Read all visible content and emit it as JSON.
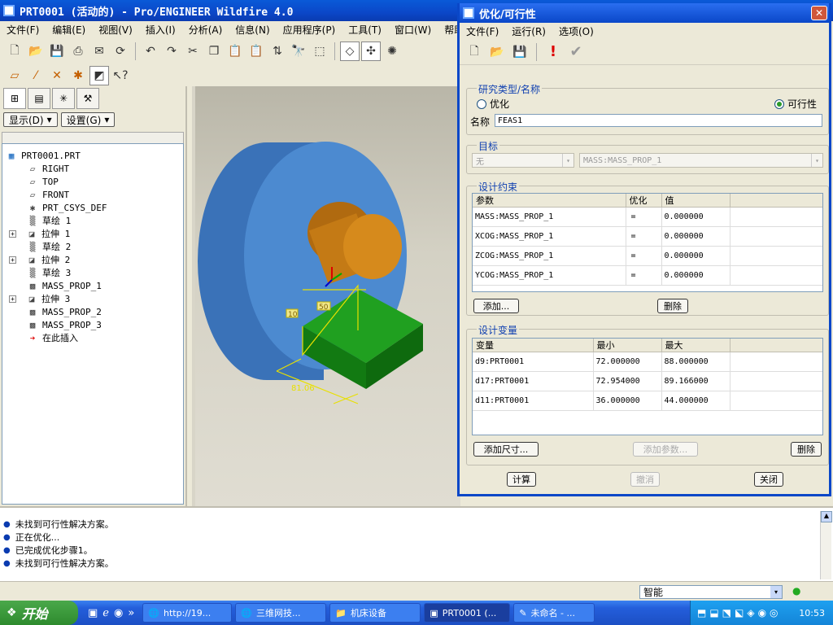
{
  "app": {
    "title": "PRT0001 (活动的) - Pro/ENGINEER Wildfire 4.0",
    "menu": [
      "文件(F)",
      "编辑(E)",
      "视图(V)",
      "插入(I)",
      "分析(A)",
      "信息(N)",
      "应用程序(P)",
      "工具(T)",
      "窗口(W)",
      "帮助(H)"
    ]
  },
  "navigator": {
    "display_btn": "显示(D)",
    "settings_btn": "设置(G)",
    "tree": [
      {
        "label": "PRT0001.PRT",
        "icon": "part-icon",
        "indent": 0,
        "expand": false
      },
      {
        "label": "RIGHT",
        "icon": "datum-plane-icon",
        "indent": 1,
        "expand": false
      },
      {
        "label": "TOP",
        "icon": "datum-plane-icon",
        "indent": 1,
        "expand": false
      },
      {
        "label": "FRONT",
        "icon": "datum-plane-icon",
        "indent": 1,
        "expand": false
      },
      {
        "label": "PRT_CSYS_DEF",
        "icon": "csys-icon",
        "indent": 1,
        "expand": false
      },
      {
        "label": "草绘 1",
        "icon": "sketch-icon",
        "indent": 1,
        "expand": false
      },
      {
        "label": "拉伸 1",
        "icon": "extrude-icon",
        "indent": 1,
        "expand": true
      },
      {
        "label": "草绘 2",
        "icon": "sketch-icon",
        "indent": 1,
        "expand": false
      },
      {
        "label": "拉伸 2",
        "icon": "extrude-icon",
        "indent": 1,
        "expand": true
      },
      {
        "label": "草绘 3",
        "icon": "sketch-icon",
        "indent": 1,
        "expand": false
      },
      {
        "label": "MASS_PROP_1",
        "icon": "analysis-icon",
        "indent": 1,
        "expand": false
      },
      {
        "label": "拉伸 3",
        "icon": "extrude-icon",
        "indent": 1,
        "expand": true
      },
      {
        "label": "MASS_PROP_2",
        "icon": "analysis-icon",
        "indent": 1,
        "expand": false
      },
      {
        "label": "MASS_PROP_3",
        "icon": "analysis-icon",
        "indent": 1,
        "expand": false
      },
      {
        "label": "在此插入",
        "icon": "insert-arrow-icon",
        "indent": 1,
        "expand": false
      }
    ]
  },
  "viewport": {
    "dims": [
      "10",
      "50",
      "81.06"
    ]
  },
  "messages": [
    "未找到可行性解决方案。",
    "正在优化...",
    "已完成优化步骤1。",
    "未找到可行性解决方案。"
  ],
  "status": {
    "filter": "智能"
  },
  "dialog": {
    "title": "优化/可行性",
    "menu": [
      "文件(F)",
      "运行(R)",
      "选项(O)"
    ],
    "study_group": "研究类型/名称",
    "radio_opt": "优化",
    "radio_feas": "可行性",
    "selected": "可行性",
    "name_label": "名称",
    "name_value": "FEAS1",
    "goal_group": "目标",
    "goal_select": "无",
    "goal_param": "MASS:MASS_PROP_1",
    "constraints_group": "设计约束",
    "constraints_headers": [
      "参数",
      "优化",
      "值"
    ],
    "constraints": [
      {
        "param": "MASS:MASS_PROP_1",
        "op": "=",
        "value": "0.000000"
      },
      {
        "param": "XCOG:MASS_PROP_1",
        "op": "=",
        "value": "0.000000"
      },
      {
        "param": "ZCOG:MASS_PROP_1",
        "op": "=",
        "value": "0.000000"
      },
      {
        "param": "YCOG:MASS_PROP_1",
        "op": "=",
        "value": "0.000000"
      }
    ],
    "add_btn": "添加...",
    "delete_btn": "删除",
    "variables_group": "设计变量",
    "variables_headers": [
      "变量",
      "最小",
      "最大"
    ],
    "variables": [
      {
        "var": "d9:PRT0001",
        "min": "72.000000",
        "max": "88.000000"
      },
      {
        "var": "d17:PRT0001",
        "min": "72.954000",
        "max": "89.166000"
      },
      {
        "var": "d11:PRT0001",
        "min": "36.000000",
        "max": "44.000000"
      }
    ],
    "add_dim_btn": "添加尺寸...",
    "add_param_btn": "添加参数...",
    "delete_var_btn": "删除",
    "compute_btn": "计算",
    "undo_btn": "撤消",
    "close_btn": "关闭"
  },
  "taskbar": {
    "start": "开始",
    "tasks": [
      "http://19...",
      "三维网技...",
      "机床设备",
      "PRT0001 (...",
      "未命名 - ..."
    ],
    "clock": "10:53"
  }
}
